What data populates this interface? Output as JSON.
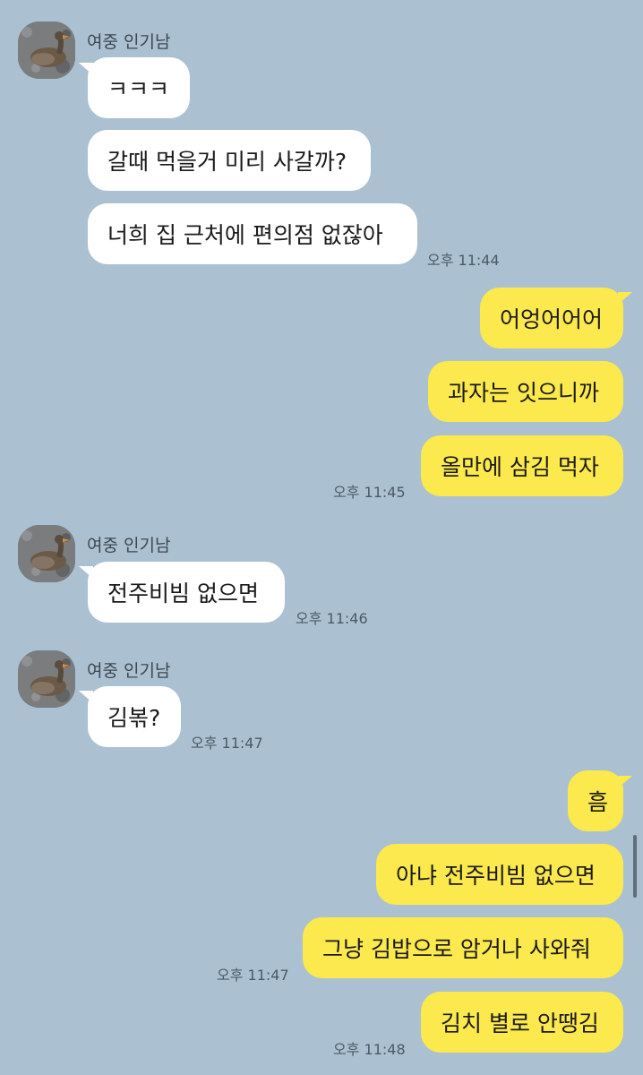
{
  "groups": [
    {
      "sender": "여중 인기남",
      "messages": [
        "ㅋㅋㅋ",
        "갈때 먹을거 미리 사갈까?",
        "너희 집 근처에 편의점 없잖아"
      ],
      "time": "오후 11:44"
    },
    {
      "sender_self": true,
      "messages": [
        "어엉어어어",
        "과자는 잇으니까",
        "올만에 삼김 먹자"
      ],
      "time": "오후 11:45"
    },
    {
      "sender": "여중 인기남",
      "messages": [
        "전주비빔 없으면"
      ],
      "time": "오후 11:46"
    },
    {
      "sender": "여중 인기남",
      "messages": [
        "김볶?"
      ],
      "time": "오후 11:47"
    },
    {
      "sender_self": true,
      "messages": [
        "흠",
        "아냐 전주비빔 없으면",
        "그냥 김밥으로 암거나 사와줘",
        "김치 별로 안땡김"
      ],
      "times": [
        "오후 11:47",
        "오후 11:48"
      ]
    }
  ],
  "avatar_icon": "goose-photo-icon",
  "colors": {
    "background": "#abc1d1",
    "incoming_bubble": "#ffffff",
    "outgoing_bubble": "#fbe94d"
  }
}
